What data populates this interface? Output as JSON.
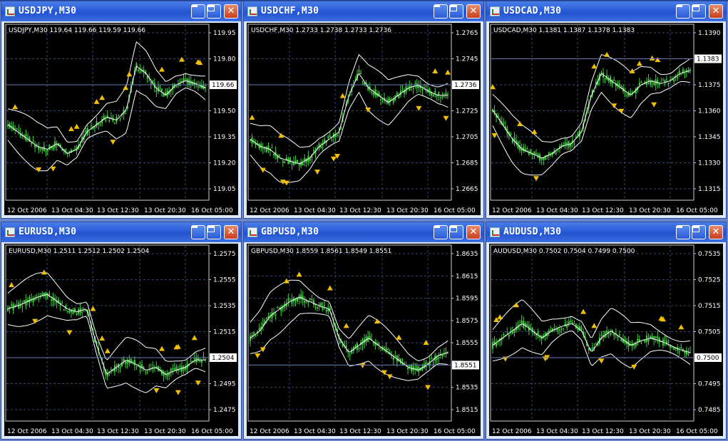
{
  "windows": [
    {
      "title": "USDJPY,M30",
      "info": "USDJPY,M30  119.64 119.66 119.59 119.66",
      "ylabels": [
        "119.95",
        "119.80",
        "119.66",
        "119.50",
        "119.35",
        "119.20",
        "119.05"
      ],
      "current": "119.66",
      "xlabels": [
        "12 Oct 2006",
        "13 Oct 04:30",
        "13 Oct 12:30",
        "13 Oct 20:30",
        "16 Oct 05:00"
      ]
    },
    {
      "title": "USDCHF,M30",
      "info": "USDCHF,M30  1.2733 1.2738 1.2733 1.2736",
      "ylabels": [
        "1.2765",
        "1.2745",
        "1.2736",
        "1.2725",
        "1.2705",
        "1.2685",
        "1.2665"
      ],
      "current": "1.2736",
      "xlabels": [
        "12 Oct 2006",
        "13 Oct 04:30",
        "13 Oct 12:30",
        "13 Oct 20:30",
        "16 Oct 05:00"
      ]
    },
    {
      "title": "USDCAD,M30",
      "info": "USDCAD,M30  1.1381 1.1387 1.1378 1.1383",
      "ylabels": [
        "1.1390",
        "1.1383",
        "1.1375",
        "1.1360",
        "1.1345",
        "1.1330",
        "1.1315"
      ],
      "current": "1.1383",
      "xlabels": [
        "12 Oct 2006",
        "13 Oct 04:30",
        "13 Oct 12:30",
        "13 Oct 20:30",
        "16 Oct 05:00"
      ]
    },
    {
      "title": "EURUSD,M30",
      "info": "EURUSD,M30  1.2511 1.2512 1.2502 1.2504",
      "ylabels": [
        "1.2575",
        "1.2555",
        "1.2535",
        "1.2515",
        "1.2504",
        "1.2495",
        "1.2475"
      ],
      "current": "1.2504",
      "xlabels": [
        "12 Oct 2006",
        "13 Oct 04:30",
        "13 Oct 12:30",
        "13 Oct 20:30",
        "16 Oct 05:00"
      ]
    },
    {
      "title": "GBPUSD,M30",
      "info": "GBPUSD,M30  1.8559 1.8561 1.8549 1.8551",
      "ylabels": [
        "1.8635",
        "1.8615",
        "1.8595",
        "1.8575",
        "1.8555",
        "1.8551",
        "1.8535",
        "1.8515"
      ],
      "current": "1.8551",
      "xlabels": [
        "12 Oct 2006",
        "13 Oct 04:30",
        "13 Oct 12:30",
        "13 Oct 20:30",
        "16 Oct 05:00"
      ]
    },
    {
      "title": "AUDUSD,M30",
      "info": "AUDUSD,M30  0.7502 0.7504 0.7499 0.7500",
      "ylabels": [
        "0.7535",
        "0.7525",
        "0.7515",
        "0.7505",
        "0.7500",
        "0.7495",
        "0.7485"
      ],
      "current": "0.7500",
      "xlabels": [
        "12 Oct 2006",
        "13 Oct 04:30",
        "13 Oct 12:30",
        "13 Oct 20:30",
        "16 Oct 05:00"
      ]
    }
  ],
  "buttons": {
    "minimize": "_",
    "maximize": "□",
    "close": "✕"
  },
  "colors": {
    "candle": "#3fd13f",
    "band": "#ffffff",
    "fractal": "#f0c000",
    "grid": "#2c4a7a",
    "priceline": "#6a78b8",
    "titlebar": "#2a5cd8"
  },
  "icons": {
    "app": "chart-app-icon",
    "minimize": "minimize-icon",
    "maximize": "maximize-icon",
    "close": "close-icon"
  }
}
